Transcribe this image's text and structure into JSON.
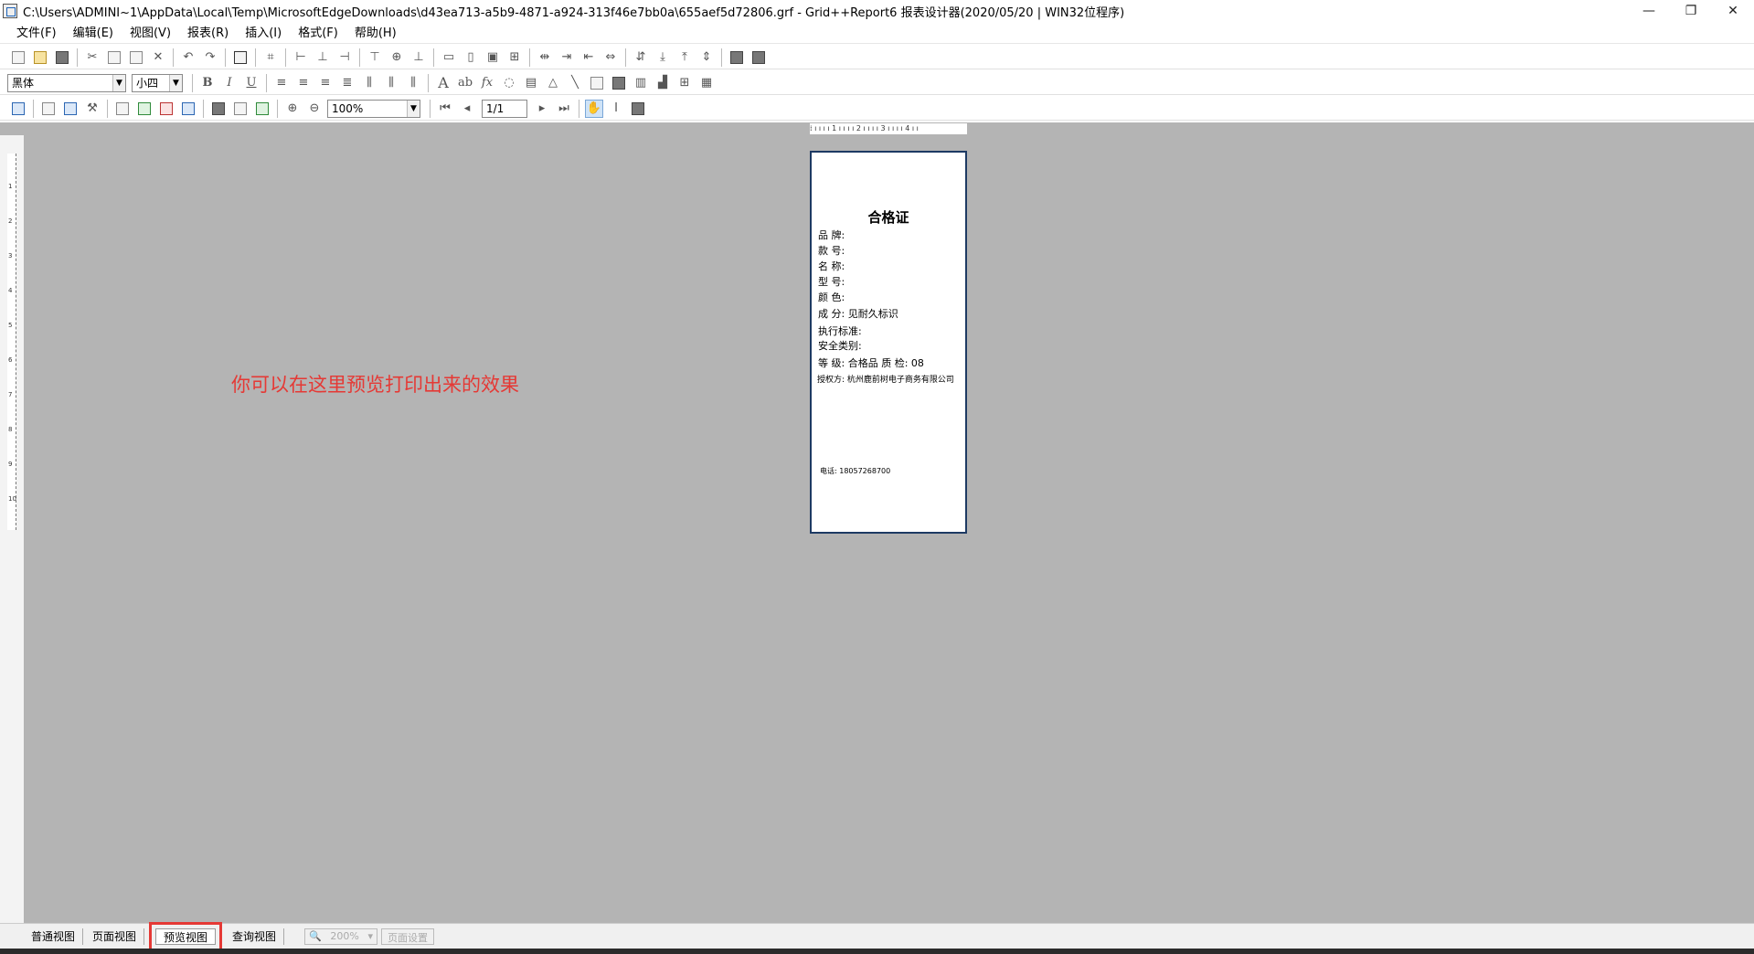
{
  "window": {
    "title": "C:\\Users\\ADMINI~1\\AppData\\Local\\Temp\\MicrosoftEdgeDownloads\\d43ea713-a5b9-4871-a924-313f46e7bb0a\\655aef5d72806.grf - Grid++Report6 报表设计器(2020/05/20 | WIN32位程序)",
    "minimize": "—",
    "restore": "❐",
    "close": "✕"
  },
  "menu": [
    {
      "label": "文件(F)"
    },
    {
      "label": "编辑(E)"
    },
    {
      "label": "视图(V)"
    },
    {
      "label": "报表(R)"
    },
    {
      "label": "插入(I)"
    },
    {
      "label": "格式(F)"
    },
    {
      "label": "帮助(H)"
    }
  ],
  "format_toolbar": {
    "font_name": "黑体",
    "font_size": "小四",
    "bold": "B",
    "italic": "I",
    "underline": "U",
    "text_a": "A",
    "text_ab": "ab",
    "fx": "fx"
  },
  "preview_toolbar": {
    "zoom": "100%",
    "page": "1/1"
  },
  "ruler": {
    "horizontal": "⁞ ı ı ı ı 1 ı ı ı ı 2 ı ı ı ı 3 ı ı ı ı 4 ı ı",
    "vertical_labels": [
      "1",
      "2",
      "3",
      "4",
      "5",
      "6",
      "7",
      "8",
      "9",
      "10"
    ]
  },
  "annotation": "你可以在这里预览打印出来的效果",
  "certificate": {
    "title": "合格证",
    "brand": "品  牌:",
    "style_no": "款  号:",
    "name": "名  称:",
    "model": "型  号:",
    "color": "颜  色:",
    "composition": "成  分:    见耐久标识",
    "standard": "执行标准:",
    "safety": "安全类别:",
    "grade": "等  级:  合格品   质  检: 08",
    "licensor": "授权方: 杭州鹿前树电子商务有限公司",
    "phone": "电话: 18057268700"
  },
  "view_tabs": [
    {
      "label": "普通视图"
    },
    {
      "label": "页面视图"
    },
    {
      "label": "预览视图",
      "active": true
    },
    {
      "label": "查询视图"
    }
  ],
  "status": {
    "zoom": "200%",
    "page_setup": "页面设置"
  }
}
